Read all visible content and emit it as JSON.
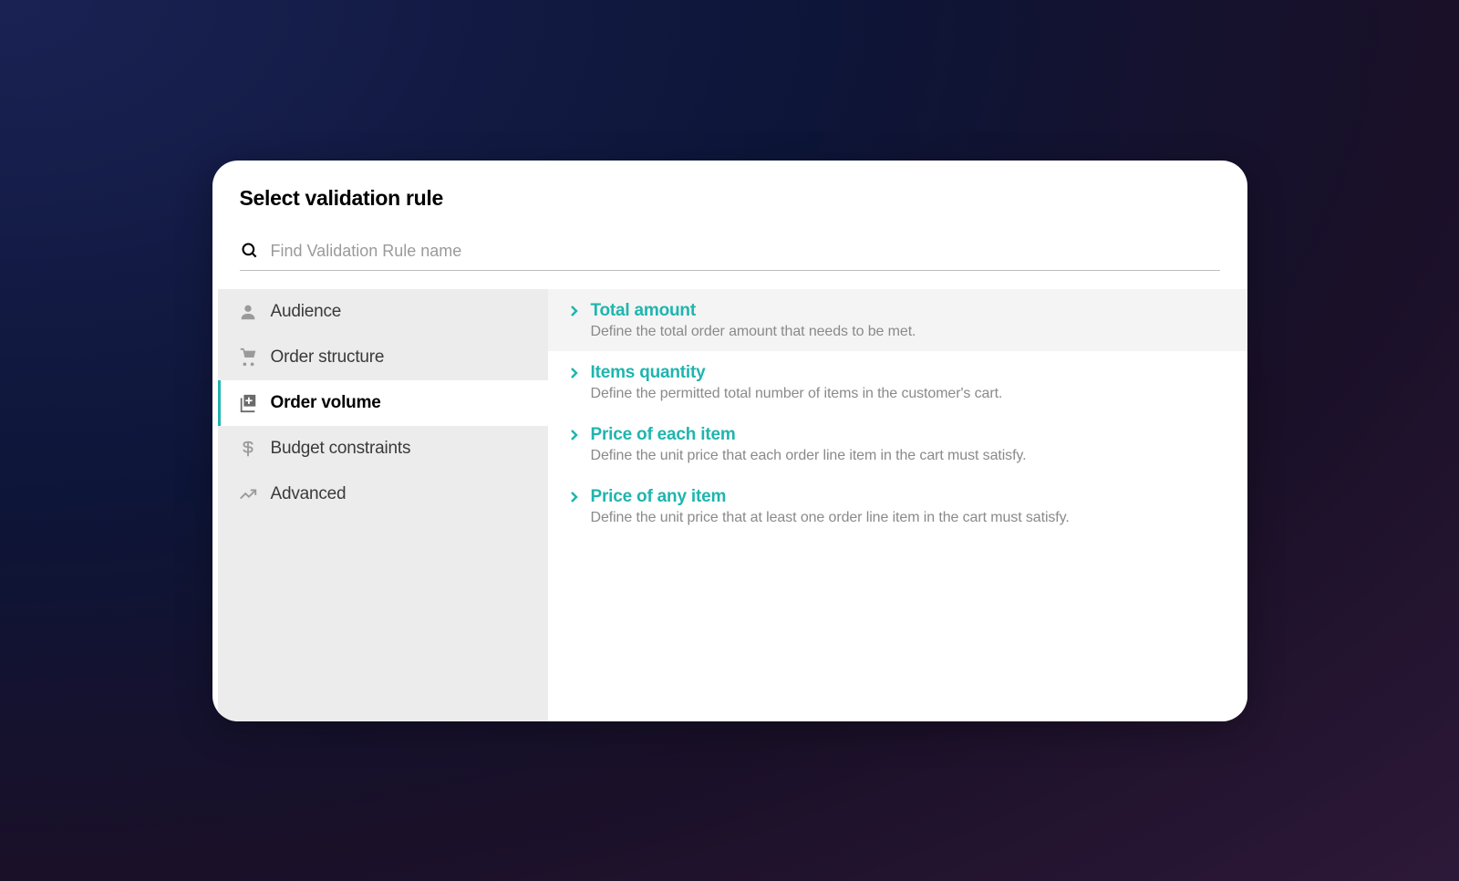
{
  "header": {
    "title": "Select validation rule"
  },
  "search": {
    "placeholder": "Find Validation Rule name"
  },
  "sidebar": {
    "items": [
      {
        "label": "Audience",
        "icon": "user-icon"
      },
      {
        "label": "Order structure",
        "icon": "cart-icon"
      },
      {
        "label": "Order volume",
        "icon": "add-box-icon"
      },
      {
        "label": "Budget constraints",
        "icon": "dollar-icon"
      },
      {
        "label": "Advanced",
        "icon": "trend-icon"
      }
    ]
  },
  "rules": [
    {
      "title": "Total amount",
      "desc": "Define the total order amount that needs to be met."
    },
    {
      "title": "Items quantity",
      "desc": "Define the permitted total number of items in the customer's cart."
    },
    {
      "title": "Price of each item",
      "desc": "Define the unit price that each order line item in the cart must satisfy."
    },
    {
      "title": "Price of any item",
      "desc": "Define the unit price that at least one order line item in the cart must satisfy."
    }
  ]
}
